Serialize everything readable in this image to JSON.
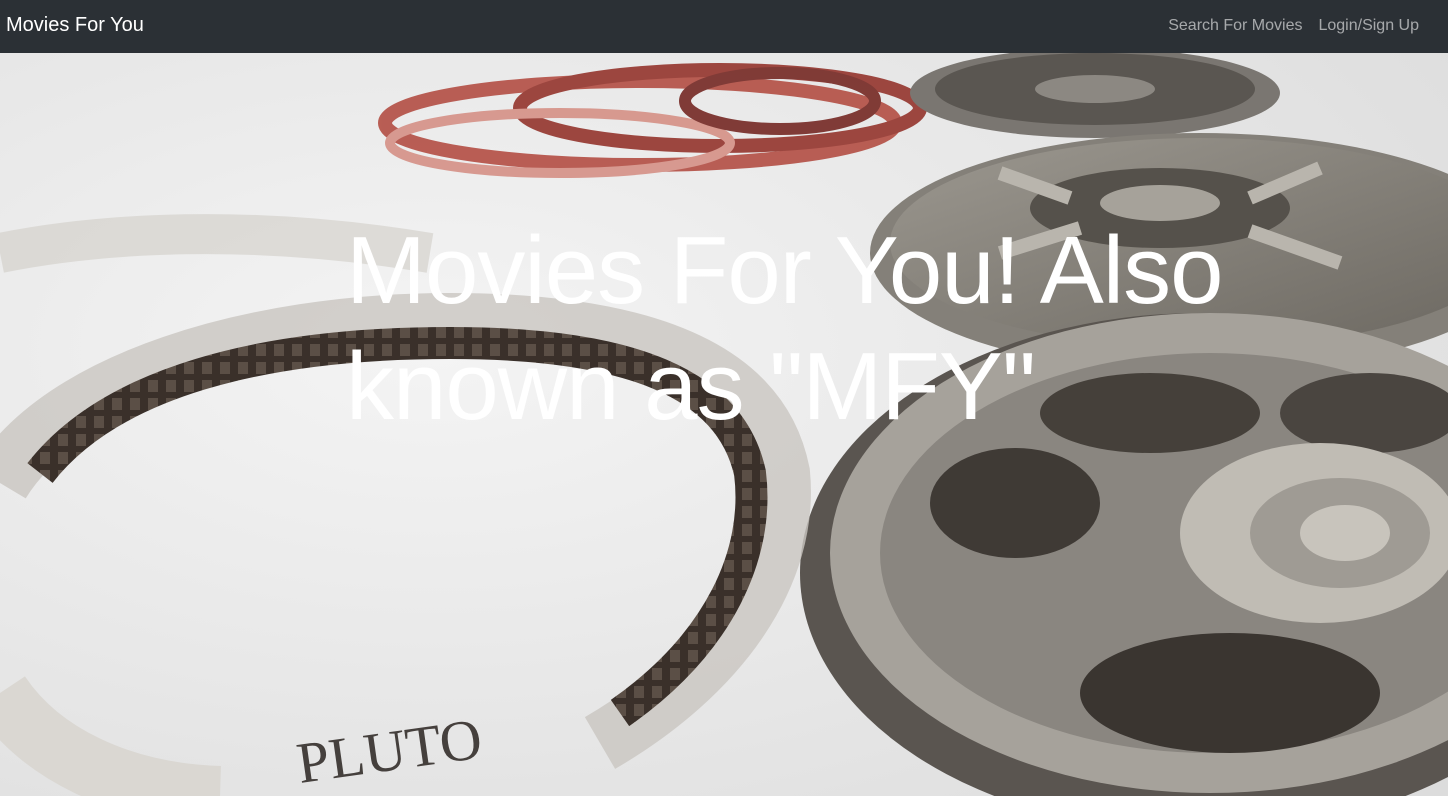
{
  "navbar": {
    "brand": "Movies For You",
    "links": [
      {
        "label": "Search For Movies"
      },
      {
        "label": "Login/Sign Up"
      }
    ]
  },
  "hero": {
    "title": "Movies For You! Also known as \"MFY\"",
    "background_image": "film-reels-photo",
    "reel_lettering": "PLUTO"
  },
  "colors": {
    "navbar_bg": "#2b3035",
    "brand_text": "#ffffff",
    "link_text": "rgba(255,255,255,0.58)",
    "title_text": "#ffffff"
  }
}
